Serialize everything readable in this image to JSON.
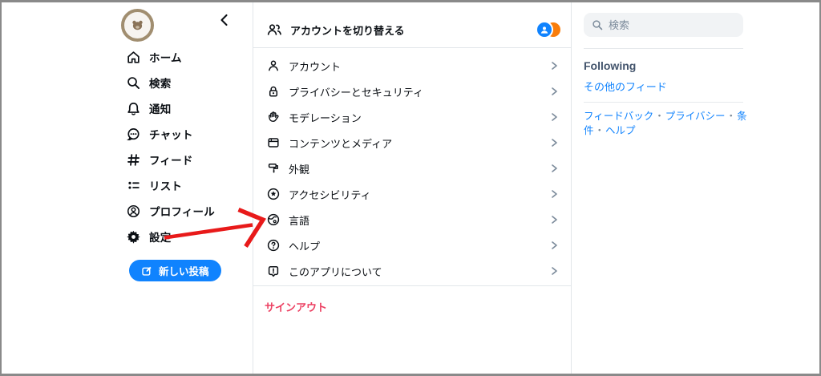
{
  "left_sidebar": {
    "nav": [
      {
        "label": "ホーム"
      },
      {
        "label": "検索"
      },
      {
        "label": "通知"
      },
      {
        "label": "チャット"
      },
      {
        "label": "フィード"
      },
      {
        "label": "リスト"
      },
      {
        "label": "プロフィール"
      },
      {
        "label": "設定"
      }
    ],
    "new_post_label": "新しい投稿"
  },
  "settings_panel": {
    "switch_account_label": "アカウントを切り替える",
    "items": [
      {
        "label": "アカウント"
      },
      {
        "label": "プライバシーとセキュリティ"
      },
      {
        "label": "モデレーション"
      },
      {
        "label": "コンテンツとメディア"
      },
      {
        "label": "外観"
      },
      {
        "label": "アクセシビリティ"
      },
      {
        "label": "言語"
      },
      {
        "label": "ヘルプ"
      },
      {
        "label": "このアプリについて"
      }
    ],
    "sign_out_label": "サインアウト"
  },
  "right_sidebar": {
    "search_placeholder": "検索",
    "feed_title": "Following",
    "more_feeds_label": "その他のフィード",
    "footer_links": [
      "フィードバック",
      "プライバシー",
      "条件",
      "ヘルプ"
    ],
    "footer_separator": "・"
  },
  "colors": {
    "accent_blue": "#1083fe",
    "signout_pink": "#ec3f61",
    "arrow_red": "#e81a1a",
    "avatar_ring": "#a18e70",
    "avatar_orange": "#f97d0b",
    "frame_border": "#8a8a8a"
  }
}
